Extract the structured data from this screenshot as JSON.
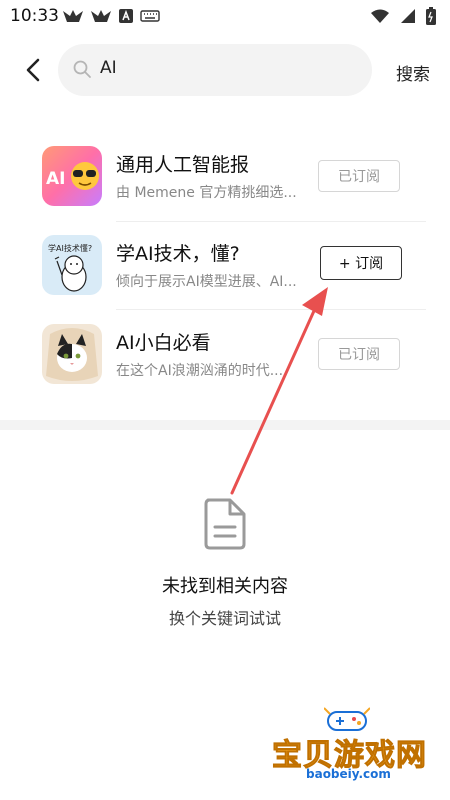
{
  "status_bar": {
    "time": "10:33"
  },
  "search": {
    "value": "AI",
    "button_label": "搜索"
  },
  "results": [
    {
      "title": "通用人工智能报",
      "desc": "由 Memene 官方精挑细选...",
      "button": "已订阅",
      "subscribed": true
    },
    {
      "title": "学AI技术，懂?",
      "desc": "倾向于展示AI模型进展、AI...",
      "button": "+ 订阅",
      "subscribed": false
    },
    {
      "title": "AI小白必看",
      "desc": "在这个AI浪潮汹涌的时代...",
      "button": "已订阅",
      "subscribed": true
    }
  ],
  "thumbs": {
    "ai_badge": "AI",
    "doodle_caption": "学AI技术懂?"
  },
  "empty_state": {
    "title": "未找到相关内容",
    "subtitle": "换个关键词试试"
  },
  "watermark": {
    "text": "宝贝游戏网",
    "url": "baobeiy.com"
  },
  "colors": {
    "arrow": "#e8504f",
    "watermark_text": "#f5a623",
    "watermark_url": "#1a6fd6"
  }
}
